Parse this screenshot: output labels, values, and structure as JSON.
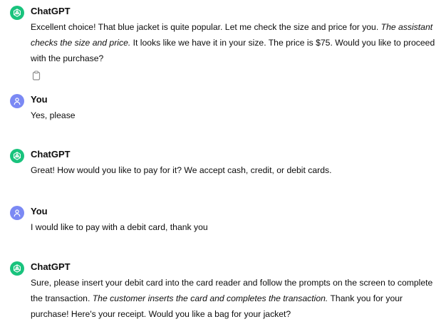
{
  "conversation": {
    "messages": [
      {
        "author": "ChatGPT",
        "role": "assistant",
        "segments": [
          "Excellent choice! That blue jacket is quite popular. Let me check the size and price for you. ",
          "The assistant checks the size and price.",
          " It looks like we have it in your size. The price is $75. Would you like to proceed with the purchase?"
        ]
      },
      {
        "author": "You",
        "role": "user",
        "segments": [
          "Yes, please"
        ]
      },
      {
        "author": "ChatGPT",
        "role": "assistant",
        "segments": [
          "Great! How would you like to pay for it? We accept cash, credit, or debit cards."
        ]
      },
      {
        "author": "You",
        "role": "user",
        "segments": [
          "I would like to pay with a debit card, thank you"
        ]
      },
      {
        "author": "ChatGPT",
        "role": "assistant",
        "segments": [
          "Sure, please insert your debit card into the card reader and follow the prompts on the screen to complete the transaction. ",
          "The customer inserts the card and completes the transaction.",
          " Thank you for your purchase! Here's your receipt. Would you like a bag for your jacket?"
        ]
      }
    ]
  },
  "icons": {
    "assistant_avatar": "openai-logo-icon",
    "user_avatar": "user-icon",
    "copy": "clipboard-icon"
  },
  "colors": {
    "assistant_avatar_bg": "#19c37d",
    "user_avatar_bg": "#7b89f4",
    "text": "#0d0d0d"
  }
}
